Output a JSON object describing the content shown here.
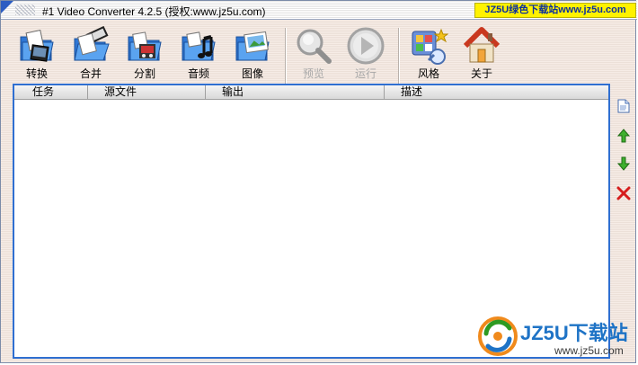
{
  "window": {
    "title": "#1 Video Converter 4.2.5 (授权:www.jz5u.com)",
    "badge": "JZ5U绿色下载站www.jz5u.com"
  },
  "toolbar": {
    "convert": "转换",
    "merge": "合并",
    "split": "分割",
    "audio": "音频",
    "image": "图像",
    "preview": "预览",
    "run": "运行",
    "style": "风格",
    "about": "关于"
  },
  "list": {
    "columns": [
      "任务",
      "源文件",
      "输出",
      "描述"
    ]
  },
  "watermark": {
    "name": "JZ5U下载站",
    "url": "www.jz5u.com"
  },
  "colors": {
    "accent": "#2f6fd1",
    "badge_bg": "#fff200",
    "badge_text": "#0a2f9f",
    "arrow_green": "#2e9a22",
    "delete_red": "#d61d1d"
  },
  "icons": {
    "add_file": "add-file-icon",
    "move_up": "arrow-up-icon",
    "move_down": "arrow-down-icon",
    "remove": "delete-icon"
  }
}
